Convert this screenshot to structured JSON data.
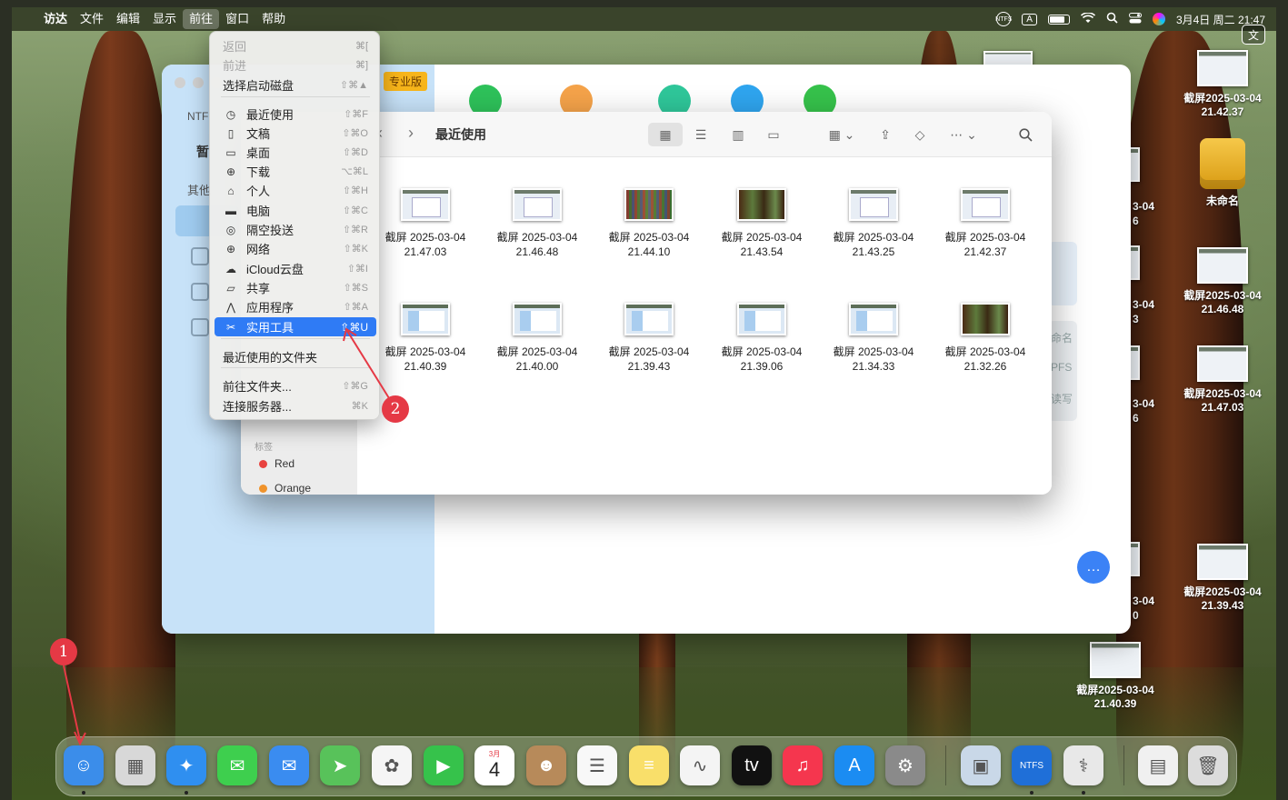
{
  "menubar": {
    "apple": "",
    "items": [
      "访达",
      "文件",
      "编辑",
      "显示",
      "前往",
      "窗口",
      "帮助"
    ],
    "active_index": 4,
    "status": {
      "ntfs": "NTFS",
      "input": "A",
      "datetime": "3月4日 周二 21:47"
    }
  },
  "go_menu": {
    "items": [
      {
        "label": "返回",
        "shortcut": "⌘[",
        "disabled": true,
        "icon": ""
      },
      {
        "label": "前进",
        "shortcut": "⌘]",
        "disabled": true,
        "icon": ""
      },
      {
        "label": "选择启动磁盘",
        "shortcut": "⇧⌘▲",
        "icon": ""
      },
      {
        "label": "最近使用",
        "shortcut": "⇧⌘F",
        "icon": "clock-icon"
      },
      {
        "label": "文稿",
        "shortcut": "⇧⌘O",
        "icon": "document-icon"
      },
      {
        "label": "桌面",
        "shortcut": "⇧⌘D",
        "icon": "desktop-icon"
      },
      {
        "label": "下载",
        "shortcut": "⌥⌘L",
        "icon": "download-icon"
      },
      {
        "label": "个人",
        "shortcut": "⇧⌘H",
        "icon": "home-icon"
      },
      {
        "label": "电脑",
        "shortcut": "⇧⌘C",
        "icon": "laptop-icon"
      },
      {
        "label": "隔空投送",
        "shortcut": "⇧⌘R",
        "icon": "airdrop-icon"
      },
      {
        "label": "网络",
        "shortcut": "⇧⌘K",
        "icon": "globe-icon"
      },
      {
        "label": "iCloud云盘",
        "shortcut": "⇧⌘I",
        "icon": "cloud-icon"
      },
      {
        "label": "共享",
        "shortcut": "⇧⌘S",
        "icon": "shared-folder-icon"
      },
      {
        "label": "应用程序",
        "shortcut": "⇧⌘A",
        "icon": "apps-icon"
      },
      {
        "label": "实用工具",
        "shortcut": "⇧⌘U",
        "icon": "tools-icon",
        "highlighted": true
      },
      {
        "label": "最近使用的文件夹",
        "shortcut": "",
        "icon": ""
      },
      {
        "label": "前往文件夹...",
        "shortcut": "⇧⌘G",
        "icon": ""
      },
      {
        "label": "连接服务器...",
        "shortcut": "⌘K",
        "icon": ""
      }
    ]
  },
  "bg_window": {
    "ntf_label": "NTF",
    "zan_label": "暂",
    "other_label": "其他",
    "pro_badge": "专业版",
    "right_labels": [
      "命名",
      "PFS",
      "读写"
    ]
  },
  "finder": {
    "title": "最近使用",
    "sidebar": {
      "tags_header": "标签",
      "tags": [
        {
          "name": "Red",
          "color": "#e8423f"
        },
        {
          "name": "Orange",
          "color": "#f0932b"
        }
      ]
    },
    "files": [
      {
        "name": "截屏 2025-03-04",
        "time": "21.47.03",
        "thumb": "light"
      },
      {
        "name": "截屏 2025-03-04",
        "time": "21.46.48",
        "thumb": "light"
      },
      {
        "name": "截屏 2025-03-04",
        "time": "21.44.10",
        "thumb": "dark"
      },
      {
        "name": "截屏 2025-03-04",
        "time": "21.43.54",
        "thumb": "forest"
      },
      {
        "name": "截屏 2025-03-04",
        "time": "21.43.25",
        "thumb": "light"
      },
      {
        "name": "截屏 2025-03-04",
        "time": "21.42.37",
        "thumb": "light"
      },
      {
        "name": "截屏 2025-03-04",
        "time": "21.40.39",
        "thumb": "blue"
      },
      {
        "name": "截屏 2025-03-04",
        "time": "21.40.00",
        "thumb": "blue"
      },
      {
        "name": "截屏 2025-03-04",
        "time": "21.39.43",
        "thumb": "blue"
      },
      {
        "name": "截屏 2025-03-04",
        "time": "21.39.06",
        "thumb": "blue"
      },
      {
        "name": "截屏 2025-03-04",
        "time": "21.34.33",
        "thumb": "blue"
      },
      {
        "name": "截屏 2025-03-04",
        "time": "21.32.26",
        "thumb": "forest"
      }
    ]
  },
  "desktop_icons": [
    {
      "name": "截屏2025-03-04",
      "time": "21.42.37",
      "kind": "thumb"
    },
    {
      "name": "未命名",
      "time": "",
      "kind": "disk"
    },
    {
      "name": "截屏2025-03-04",
      "time": "21.46.48",
      "kind": "thumb"
    },
    {
      "name": "截屏2025-03-04",
      "time": "21.47.03",
      "kind": "thumb"
    },
    {
      "name": "截屏2025-03-04",
      "time": "21.39.43",
      "kind": "thumb"
    },
    {
      "name": "截屏2025-03-04",
      "time": "21.40.39",
      "kind": "thumb"
    }
  ],
  "desktop_partial_labels": [
    "3-04",
    "6",
    "3-04",
    "3",
    "3-04",
    "6",
    "3-04",
    "0"
  ],
  "dock": {
    "apps": [
      {
        "name": "finder",
        "color": "#3b8dea",
        "glyph": "☺",
        "running": true
      },
      {
        "name": "launchpad",
        "color": "#d8d8d8",
        "glyph": "▦",
        "running": false
      },
      {
        "name": "safari",
        "color": "#2f8ff0",
        "glyph": "✦",
        "running": true
      },
      {
        "name": "messages",
        "color": "#3ecf4e",
        "glyph": "✉",
        "running": false
      },
      {
        "name": "mail",
        "color": "#3a8cf0",
        "glyph": "✉",
        "running": false
      },
      {
        "name": "maps",
        "color": "#58c25a",
        "glyph": "➤",
        "running": false
      },
      {
        "name": "photos",
        "color": "#f5f5f5",
        "glyph": "✿",
        "running": false
      },
      {
        "name": "facetime",
        "color": "#36c24b",
        "glyph": "▶",
        "running": false
      },
      {
        "name": "calendar",
        "color": "#ffffff",
        "glyph": "4",
        "running": false
      },
      {
        "name": "contacts",
        "color": "#b78a5a",
        "glyph": "☻",
        "running": false
      },
      {
        "name": "reminders",
        "color": "#f8f8f8",
        "glyph": "☰",
        "running": false
      },
      {
        "name": "notes",
        "color": "#f9df6a",
        "glyph": "≡",
        "running": false
      },
      {
        "name": "freeform",
        "color": "#f4f4f4",
        "glyph": "∿",
        "running": false
      },
      {
        "name": "tv",
        "color": "#111111",
        "glyph": "tv",
        "running": false
      },
      {
        "name": "music",
        "color": "#f5364e",
        "glyph": "♫",
        "running": false
      },
      {
        "name": "app-store",
        "color": "#1b8cf2",
        "glyph": "A",
        "running": false
      },
      {
        "name": "system-settings",
        "color": "#8a8a8a",
        "glyph": "⚙",
        "running": false
      },
      {
        "name": "preview",
        "color": "#c9d8e8",
        "glyph": "▣",
        "running": false
      },
      {
        "name": "ntfs-tool",
        "color": "#1f6fd8",
        "glyph": "NTFS",
        "running": true
      },
      {
        "name": "disk-utility",
        "color": "#e8e8e8",
        "glyph": "⚕",
        "running": true
      },
      {
        "name": "downloads-stack",
        "color": "#f0f0f0",
        "glyph": "▤",
        "running": false
      },
      {
        "name": "trash",
        "color": "#dcdcdc",
        "glyph": "🗑",
        "running": false
      }
    ],
    "calendar_month": "3月",
    "calendar_day": "4"
  },
  "annotations": {
    "badge1": "1",
    "badge2": "2",
    "color": "#e53945"
  }
}
